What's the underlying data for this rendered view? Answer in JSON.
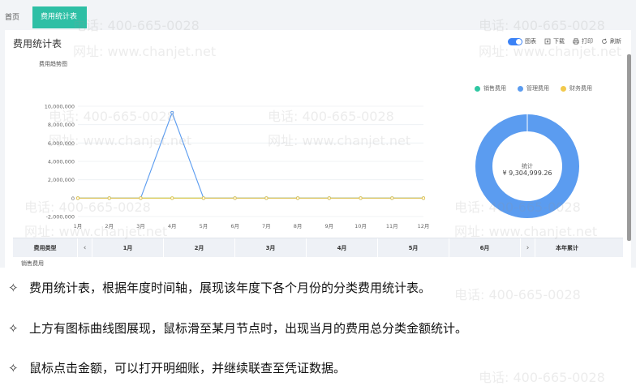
{
  "tabs": {
    "home": "首页",
    "active": "费用统计表",
    "close": "×"
  },
  "page": {
    "title": "费用统计表"
  },
  "toolbar": {
    "chart": "图表",
    "download": "下载",
    "print": "打印",
    "refresh": "刷新"
  },
  "legend": [
    {
      "label": "销售费用",
      "color": "#2fc7a2"
    },
    {
      "label": "管理费用",
      "color": "#5b9cf0"
    },
    {
      "label": "财务费用",
      "color": "#f2c94c"
    }
  ],
  "donut": {
    "label": "统计",
    "value": "¥ 9,304,999.26"
  },
  "chart_data": {
    "type": "line",
    "title": "费用趋势图",
    "x": [
      "1月",
      "2月",
      "3月",
      "4月",
      "5月",
      "6月",
      "7月",
      "8月",
      "9月",
      "10月",
      "11月",
      "12月"
    ],
    "y_ticks": [
      "10,000,000",
      "8,000,000",
      "6,000,000",
      "4,000,000",
      "2,000,000",
      "0",
      "-2,000,000"
    ],
    "ylim": [
      -2000000,
      10000000
    ],
    "series": [
      {
        "color": "#2fc7a2",
        "values": [
          0,
          0,
          0,
          0,
          0,
          0,
          0,
          0,
          0,
          0,
          0,
          0
        ]
      },
      {
        "color": "#5b9cf0",
        "values": [
          0,
          0,
          0,
          9304999.26,
          0,
          0,
          0,
          0,
          0,
          0,
          0,
          0
        ]
      },
      {
        "color": "#f2c94c",
        "values": [
          0,
          0,
          0,
          0,
          0,
          0,
          0,
          0,
          0,
          0,
          0,
          0
        ]
      }
    ],
    "pie": {
      "type": "pie",
      "values": [
        0,
        9304999.26,
        0
      ],
      "colors": [
        "#2fc7a2",
        "#5b9cf0",
        "#f2c94c"
      ]
    }
  },
  "table": {
    "first_header": "费用类型",
    "months": [
      "1月",
      "2月",
      "3月",
      "4月",
      "5月",
      "6月"
    ],
    "last_header": "本年累计",
    "prev": "‹",
    "next": "›",
    "row1": "销售费用"
  },
  "notes": [
    "费用统计表，根据年度时间轴，展现该年度下各个月份的分类费用统计表。",
    "上方有图标曲线图展现，鼠标滑至某月节点时，出现当月的费用总分类金额统计。",
    "鼠标点击金额，可以打开明细账，并继续联查至凭证数据。"
  ],
  "note_marker": "✧",
  "watermark": {
    "phone": "电话: 400-665-0028",
    "site": "网址: www.chanjet.net"
  }
}
